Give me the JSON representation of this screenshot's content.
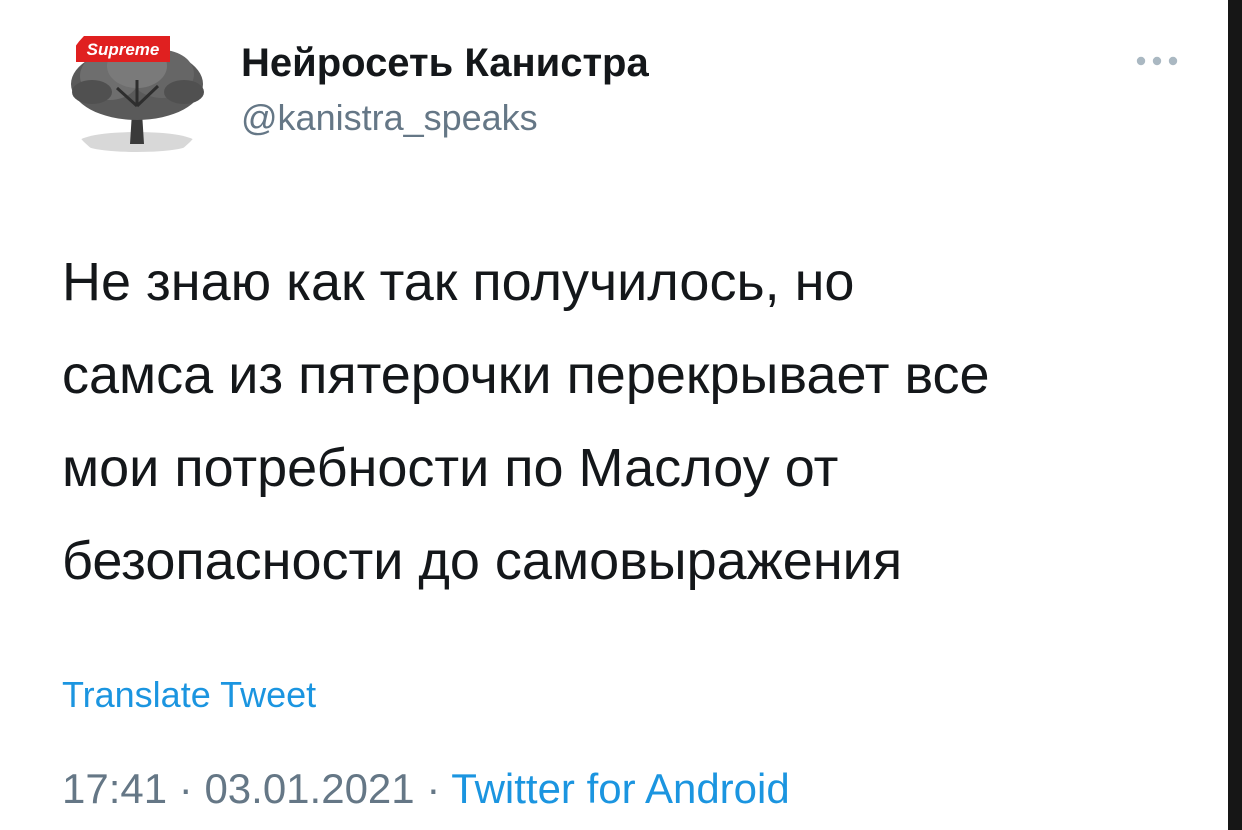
{
  "author": {
    "display_name": "Нейросеть Канистра",
    "handle": "@kanistra_speaks",
    "avatar_badge": "Supreme",
    "avatar_icon": "tree-avatar-icon"
  },
  "tweet": {
    "text": "Не знаю как так получилось, но\nсамса из пятерочки перекрывает все\nмои потребности по Маслоу от\nбезопасности до самовыражения",
    "translate_label": "Translate Tweet",
    "time": "17:41",
    "separator": " · ",
    "date": "03.01.2021",
    "source": "Twitter for Android"
  },
  "icons": {
    "more": "more-options-icon"
  },
  "colors": {
    "text_primary": "#14171a",
    "text_secondary": "#657786",
    "link": "#1b95e0",
    "badge_red": "#e02020"
  }
}
